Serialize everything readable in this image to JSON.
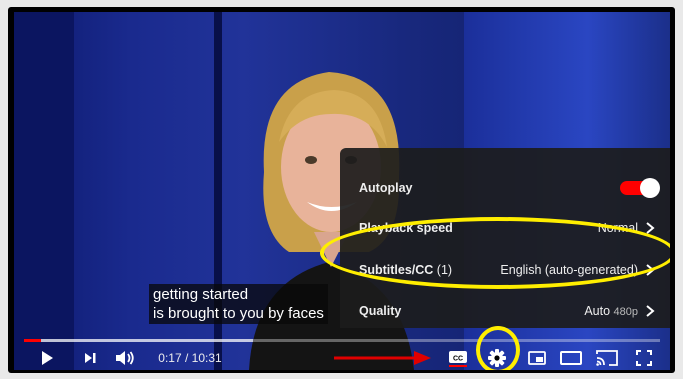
{
  "colors": {
    "accent": "#ff0000",
    "highlight": "#ffee00",
    "menu_bg": "#1c1c1c"
  },
  "captions": {
    "line1": "getting started",
    "line2": "is brought to you by faces"
  },
  "settings_menu": {
    "autoplay": {
      "label": "Autoplay",
      "enabled": true
    },
    "playback_speed": {
      "label": "Playback speed",
      "value": "Normal"
    },
    "subtitles": {
      "label": "Subtitles/CC",
      "count": "(1)",
      "value": "English (auto-generated)"
    },
    "quality": {
      "label": "Quality",
      "value": "Auto",
      "sub": "480p"
    }
  },
  "player": {
    "time": "0:17 / 10:31",
    "progress_fraction": 0.027,
    "buffer_fraction": 0.36
  },
  "icons": [
    "play-icon",
    "next-icon",
    "volume-icon",
    "subtitles-cc-icon",
    "settings-gear-icon",
    "miniplayer-icon",
    "theater-mode-icon",
    "cast-icon",
    "fullscreen-icon"
  ]
}
